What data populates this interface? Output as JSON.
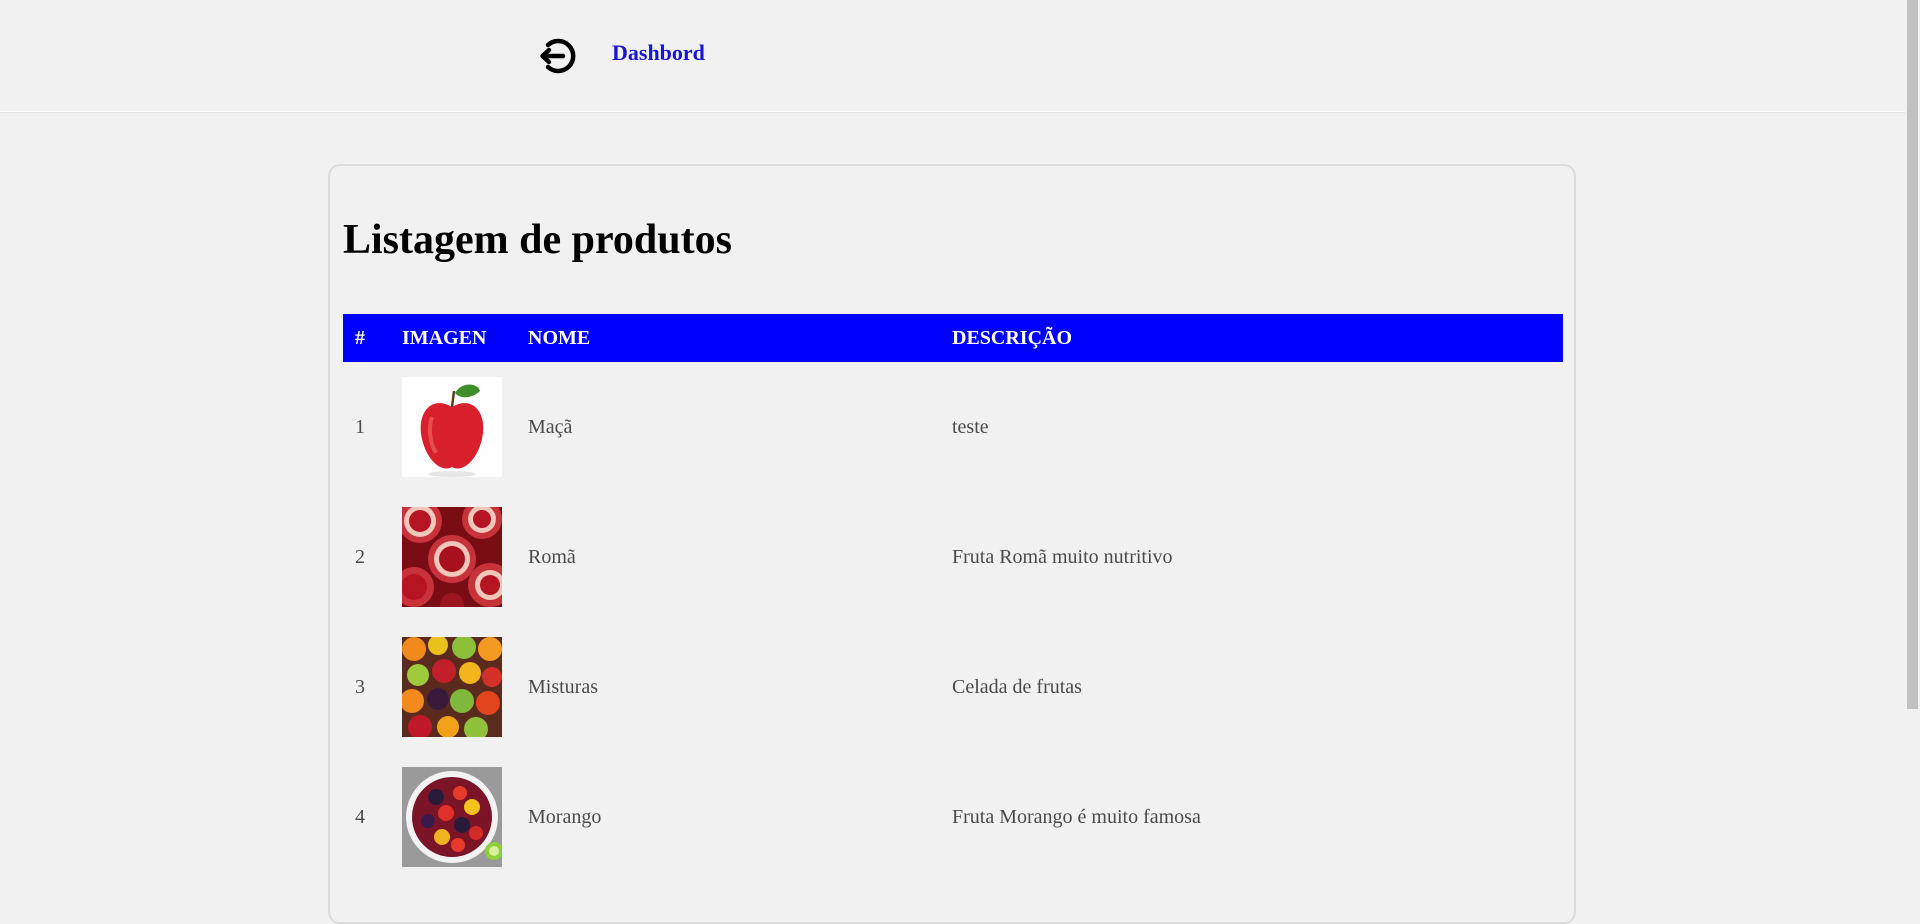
{
  "header": {
    "logout_icon": "logout-icon",
    "dashboard_link": "Dashbord",
    "link_color": "#1a14d6"
  },
  "main": {
    "title": "Listagem de produtos",
    "table": {
      "header_bg": "#0000ff",
      "columns": [
        "#",
        "IMAGEN",
        "NOME",
        "DESCRIÇÃO"
      ],
      "rows": [
        {
          "num": "1",
          "image": "apple-image",
          "name": "Maçã",
          "description": "teste"
        },
        {
          "num": "2",
          "image": "pomegranate-image",
          "name": "Romã",
          "description": "Fruta Romã muito nutritivo"
        },
        {
          "num": "3",
          "image": "mixed-fruits-image",
          "name": "Misturas",
          "description": "Celada de frutas"
        },
        {
          "num": "4",
          "image": "berry-bowl-image",
          "name": "Morango",
          "description": "Fruta Morango é muito famosa"
        }
      ]
    }
  }
}
